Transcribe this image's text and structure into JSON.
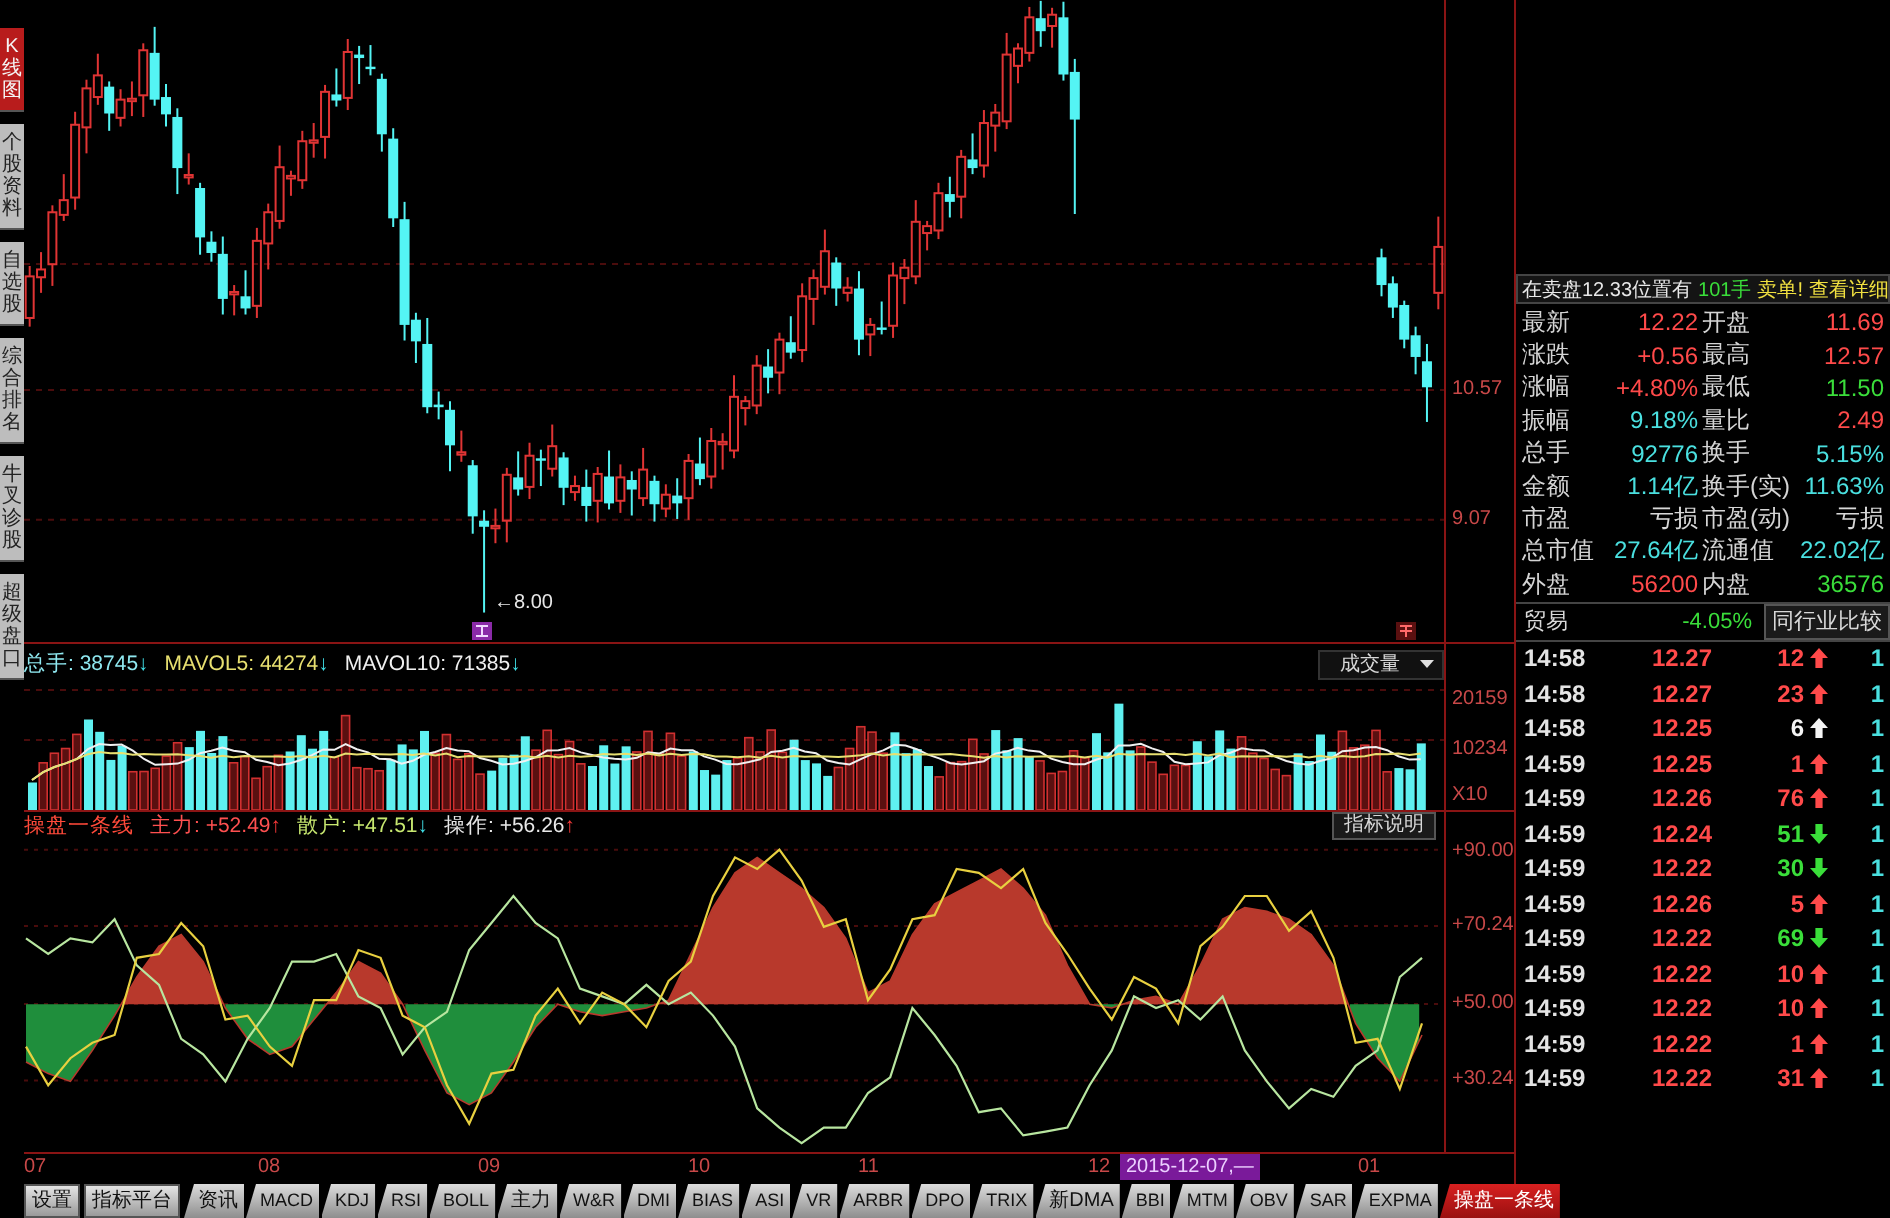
{
  "sidebar": {
    "tabs": [
      {
        "label": "K线图",
        "selected": true
      },
      {
        "label": "个股资料",
        "selected": false
      },
      {
        "label": "自选股",
        "selected": false
      },
      {
        "label": "综合排名",
        "selected": false
      },
      {
        "label": "牛叉诊股",
        "selected": false
      },
      {
        "label": "超级盘口",
        "selected": false
      }
    ]
  },
  "price_chart": {
    "low_marker": "←8.00",
    "chart_data": {
      "type": "candlestick",
      "grid": true,
      "ylim": [
        7.66,
        15.07
      ],
      "yticks": [
        {
          "value": 10.57,
          "label": "10.57"
        },
        {
          "value": 9.07,
          "label": "9.07"
        }
      ],
      "categories": [
        null,
        null,
        null,
        null,
        null,
        null,
        null,
        null,
        null,
        null,
        null,
        null,
        null,
        null,
        null,
        null,
        null,
        null,
        null,
        null,
        null,
        null,
        null,
        null,
        null,
        null,
        null,
        null,
        null,
        null,
        null,
        null,
        null,
        null,
        null,
        null,
        null,
        null,
        null,
        null,
        null,
        null,
        null,
        null,
        null,
        null,
        null,
        null,
        null,
        null,
        null,
        null,
        null,
        null,
        null,
        null,
        null,
        null,
        null,
        null,
        null,
        null,
        null,
        null,
        null,
        null,
        null,
        null,
        null,
        null,
        null,
        null,
        null,
        null,
        null,
        null,
        null,
        null,
        null,
        null,
        null,
        null,
        null,
        null,
        null,
        null,
        null,
        null,
        null,
        null,
        null,
        null,
        null,
        null,
        null,
        null,
        null,
        null,
        null,
        null,
        null,
        null,
        null,
        null,
        null,
        null,
        null,
        null,
        null,
        null,
        null,
        null,
        null,
        null,
        null,
        null,
        null,
        null,
        null,
        null,
        null,
        null,
        null,
        null,
        null
      ],
      "ohlc": [
        [
          11.4,
          12.0,
          11.3,
          11.88
        ],
        [
          11.87,
          12.16,
          11.69,
          11.96
        ],
        [
          12.02,
          12.7,
          11.77,
          12.62
        ],
        [
          12.59,
          13.06,
          12.52,
          12.76
        ],
        [
          12.79,
          13.78,
          12.65,
          13.63
        ],
        [
          13.6,
          14.15,
          13.3,
          14.05
        ],
        [
          13.95,
          14.45,
          13.86,
          14.2
        ],
        [
          14.07,
          14.13,
          13.56,
          13.76
        ],
        [
          13.71,
          14.04,
          13.61,
          13.92
        ],
        [
          13.91,
          14.13,
          13.73,
          13.93
        ],
        [
          13.97,
          14.57,
          13.72,
          14.49
        ],
        [
          14.46,
          14.76,
          13.85,
          13.92
        ],
        [
          13.95,
          14.1,
          13.61,
          13.75
        ],
        [
          13.72,
          13.82,
          12.83,
          13.13
        ],
        [
          13.03,
          13.3,
          12.94,
          13.05
        ],
        [
          12.9,
          12.96,
          12.13,
          12.33
        ],
        [
          12.28,
          12.4,
          12.05,
          12.15
        ],
        [
          12.14,
          12.34,
          11.44,
          11.62
        ],
        [
          11.68,
          11.78,
          11.43,
          11.7
        ],
        [
          11.65,
          11.95,
          11.44,
          11.51
        ],
        [
          11.54,
          12.44,
          11.4,
          12.29
        ],
        [
          12.26,
          12.72,
          11.96,
          12.62
        ],
        [
          12.52,
          13.39,
          12.43,
          13.14
        ],
        [
          13.01,
          13.1,
          12.81,
          13.04
        ],
        [
          12.99,
          13.56,
          12.89,
          13.44
        ],
        [
          13.43,
          13.65,
          13.25,
          13.45
        ],
        [
          13.49,
          14.09,
          13.24,
          14.01
        ],
        [
          13.98,
          14.28,
          13.84,
          13.91
        ],
        [
          13.94,
          14.62,
          13.8,
          14.47
        ],
        [
          14.44,
          14.54,
          14.1,
          14.4
        ],
        [
          14.3,
          14.55,
          14.2,
          14.29
        ],
        [
          14.16,
          14.22,
          13.32,
          13.52
        ],
        [
          13.47,
          13.59,
          12.45,
          12.55
        ],
        [
          12.54,
          12.74,
          11.14,
          11.32
        ],
        [
          11.38,
          11.46,
          10.88,
          11.13
        ],
        [
          11.1,
          11.4,
          10.3,
          10.37
        ],
        [
          10.4,
          10.55,
          10.23,
          10.37
        ],
        [
          10.34,
          10.44,
          9.63,
          9.93
        ],
        [
          9.83,
          10.1,
          9.74,
          9.85
        ],
        [
          9.7,
          9.76,
          8.91,
          9.11
        ],
        [
          9.06,
          9.18,
          8.0,
          8.99
        ],
        [
          8.98,
          9.2,
          8.8,
          9.0
        ],
        [
          9.06,
          9.67,
          8.81,
          9.59
        ],
        [
          9.56,
          9.86,
          9.35,
          9.42
        ],
        [
          9.45,
          9.96,
          9.31,
          9.81
        ],
        [
          9.78,
          9.88,
          9.46,
          9.76
        ],
        [
          9.66,
          10.17,
          9.57,
          9.92
        ],
        [
          9.79,
          9.85,
          9.24,
          9.44
        ],
        [
          9.39,
          9.58,
          9.29,
          9.46
        ],
        [
          9.45,
          9.65,
          9.05,
          9.23
        ],
        [
          9.29,
          9.68,
          9.04,
          9.6
        ],
        [
          9.57,
          9.87,
          9.19,
          9.26
        ],
        [
          9.29,
          9.71,
          9.15,
          9.56
        ],
        [
          9.53,
          9.63,
          9.12,
          9.42
        ],
        [
          9.32,
          9.9,
          9.23,
          9.65
        ],
        [
          9.52,
          9.58,
          9.05,
          9.25
        ],
        [
          9.2,
          9.48,
          9.1,
          9.36
        ],
        [
          9.35,
          9.55,
          9.08,
          9.26
        ],
        [
          9.32,
          9.83,
          9.07,
          9.75
        ],
        [
          9.72,
          10.02,
          9.47,
          9.54
        ],
        [
          9.57,
          10.13,
          9.43,
          9.98
        ],
        [
          9.95,
          10.07,
          9.65,
          9.97
        ],
        [
          9.87,
          10.74,
          9.78,
          10.49
        ],
        [
          10.36,
          10.5,
          10.16,
          10.44
        ],
        [
          10.39,
          10.97,
          10.29,
          10.85
        ],
        [
          10.84,
          11.04,
          10.53,
          10.71
        ],
        [
          10.77,
          11.23,
          10.52,
          11.15
        ],
        [
          11.12,
          11.42,
          10.93,
          11.0
        ],
        [
          11.03,
          11.8,
          10.89,
          11.65
        ],
        [
          11.62,
          11.96,
          11.32,
          11.86
        ],
        [
          11.76,
          12.42,
          11.67,
          12.17
        ],
        [
          12.04,
          12.1,
          11.54,
          11.74
        ],
        [
          11.69,
          11.87,
          11.59,
          11.75
        ],
        [
          11.74,
          11.94,
          10.97,
          11.15
        ],
        [
          11.21,
          11.4,
          10.96,
          11.32
        ],
        [
          11.29,
          11.59,
          11.21,
          11.28
        ],
        [
          11.31,
          12.04,
          11.17,
          11.89
        ],
        [
          11.86,
          12.08,
          11.56,
          11.98
        ],
        [
          11.88,
          12.76,
          11.79,
          12.51
        ],
        [
          12.38,
          12.52,
          12.18,
          12.46
        ],
        [
          12.41,
          12.96,
          12.31,
          12.84
        ],
        [
          12.83,
          13.03,
          12.56,
          12.74
        ],
        [
          12.8,
          13.34,
          12.55,
          13.26
        ],
        [
          13.23,
          13.53,
          13.06,
          13.13
        ],
        [
          13.16,
          13.8,
          13.02,
          13.65
        ],
        [
          13.62,
          13.87,
          13.32,
          13.77
        ],
        [
          13.67,
          14.69,
          13.58,
          14.44
        ],
        [
          14.31,
          14.57,
          14.11,
          14.51
        ],
        [
          14.46,
          14.99,
          14.36,
          14.87
        ],
        [
          14.86,
          15.06,
          14.53,
          14.71
        ],
        [
          14.77,
          14.98,
          14.52,
          14.9
        ],
        [
          14.87,
          15.05,
          14.14,
          14.21
        ],
        [
          14.24,
          14.39,
          12.6,
          13.69
        ],
        null,
        null,
        null,
        null,
        null,
        null,
        null,
        null,
        null,
        null,
        null,
        null,
        null,
        null,
        null,
        null,
        null,
        null,
        null,
        null,
        null,
        null,
        null,
        null,
        null,
        null,
        [
          12.1,
          12.2,
          11.65,
          11.78
        ],
        [
          11.8,
          11.88,
          11.4,
          11.52
        ],
        [
          11.55,
          11.6,
          11.05,
          11.15
        ],
        [
          11.2,
          11.3,
          10.75,
          10.95
        ],
        [
          10.9,
          11.1,
          10.2,
          10.6
        ],
        [
          11.69,
          12.57,
          11.5,
          12.22
        ]
      ]
    }
  },
  "volume_chart": {
    "legend": [
      {
        "text": "总手: 38745",
        "arrow": "↓",
        "rising": false,
        "color": "#8fe8f0"
      },
      {
        "text": "MAVOL5: 44274",
        "arrow": "↓",
        "rising": false,
        "color": "#e8e070"
      },
      {
        "text": "MAVOL10: 71385",
        "arrow": "↓",
        "rising": false,
        "color": "#f0f0f0"
      }
    ],
    "selector": "成交量",
    "axis_labels": [
      "20159",
      "10234",
      "X10"
    ]
  },
  "indicator_chart": {
    "name": "操盘一条线",
    "legend": [
      {
        "text": "主力: +52.49",
        "arrow": "↑",
        "rising": true,
        "color": "#ff5050"
      },
      {
        "text": "散户: +47.51",
        "arrow": "↓",
        "rising": false,
        "color": "#c8e870"
      },
      {
        "text": "操作: +56.26",
        "arrow": "↑",
        "rising": true,
        "color": "#e8e8e8"
      }
    ],
    "help_button": "指标说明",
    "chart_data": {
      "type": "line",
      "grid": true,
      "ylim": [
        11.7,
        92.5
      ],
      "yticks": [
        {
          "value": 90,
          "label": "+90.00"
        },
        {
          "value": 70.24,
          "label": "+70.24"
        },
        {
          "value": 50,
          "label": "+50.00"
        },
        {
          "value": 30.24,
          "label": "+30.24"
        }
      ],
      "series": [
        {
          "color": "#b8392c",
          "values": [
            35,
            32,
            30,
            38,
            47,
            57,
            65,
            68,
            61,
            49,
            41,
            37,
            39,
            46,
            53,
            61,
            58,
            50,
            38,
            27,
            24,
            27,
            35,
            44,
            50,
            48,
            47,
            48,
            49,
            51,
            63,
            75,
            84,
            88,
            84,
            80,
            75,
            67,
            53,
            56,
            68,
            76,
            79,
            82,
            85,
            80,
            73,
            60,
            50,
            49,
            51,
            52,
            50,
            60,
            72,
            75,
            74,
            72,
            68,
            60,
            45,
            36,
            30,
            42
          ]
        },
        {
          "color": "#b8e6a0",
          "values": [
            67,
            63,
            67,
            66,
            72,
            60,
            55,
            41,
            37,
            30,
            41,
            49,
            61,
            61,
            63,
            52,
            49,
            37,
            44,
            48,
            64,
            71,
            78,
            71,
            67,
            54,
            52,
            50,
            55,
            50,
            53,
            47,
            39,
            23,
            18,
            14,
            18,
            18,
            27,
            31,
            49,
            42,
            34,
            22,
            23,
            16,
            17,
            18,
            29,
            38,
            52,
            49,
            51,
            46,
            52,
            38,
            30,
            23,
            28,
            26,
            34,
            38,
            57,
            62
          ]
        },
        {
          "color": "#e8d040",
          "values": [
            39,
            29,
            36,
            40,
            42,
            62,
            63,
            71,
            65,
            46,
            47,
            39,
            34,
            51,
            51,
            64,
            62,
            47,
            44,
            29,
            19,
            32,
            33,
            47,
            54,
            45,
            53,
            50,
            44,
            56,
            61,
            78,
            88,
            85,
            90,
            82,
            70,
            72,
            51,
            59,
            72,
            73,
            85,
            84,
            80,
            85,
            71,
            63,
            54,
            46,
            57,
            54,
            45,
            65,
            70,
            78,
            78,
            69,
            74,
            62,
            40,
            41,
            28,
            45
          ]
        }
      ]
    }
  },
  "time_axis": {
    "labels": [
      "07",
      "08",
      "09",
      "10",
      "11",
      "12",
      "01"
    ],
    "cursor_date": "2015-12-07,—"
  },
  "toolbar": {
    "buttons": [
      "设置",
      "指标平台"
    ],
    "tabs": [
      {
        "label": "资讯",
        "selected": false
      },
      {
        "label": "MACD",
        "selected": false
      },
      {
        "label": "KDJ",
        "selected": false
      },
      {
        "label": "RSI",
        "selected": false
      },
      {
        "label": "BOLL",
        "selected": false
      },
      {
        "label": "主力",
        "selected": false
      },
      {
        "label": "W&R",
        "selected": false
      },
      {
        "label": "DMI",
        "selected": false
      },
      {
        "label": "BIAS",
        "selected": false
      },
      {
        "label": "ASI",
        "selected": false
      },
      {
        "label": "VR",
        "selected": false
      },
      {
        "label": "ARBR",
        "selected": false
      },
      {
        "label": "DPO",
        "selected": false
      },
      {
        "label": "TRIX",
        "selected": false
      },
      {
        "label": "新DMA",
        "selected": false
      },
      {
        "label": "BBI",
        "selected": false
      },
      {
        "label": "MTM",
        "selected": false
      },
      {
        "label": "OBV",
        "selected": false
      },
      {
        "label": "SAR",
        "selected": false
      },
      {
        "label": "EXPMA",
        "selected": false
      },
      {
        "label": "操盘一条线",
        "selected": true
      }
    ]
  },
  "quote_panel": {
    "notice": {
      "text": "在卖盘12.33位置有",
      "volume": "101手",
      "order_type": "卖单!",
      "link": "查看详细"
    },
    "stats": [
      {
        "cells": [
          {
            "label": "最新",
            "value": "12.22",
            "color": "#ff4a4a"
          },
          {
            "label": "开盘",
            "value": "11.69",
            "color": "#ff4a4a"
          }
        ]
      },
      {
        "cells": [
          {
            "label": "涨跌",
            "value": "+0.56",
            "color": "#ff4a4a"
          },
          {
            "label": "最高",
            "value": "12.57",
            "color": "#ff4a4a"
          }
        ]
      },
      {
        "cells": [
          {
            "label": "涨幅",
            "value": "+4.80%",
            "color": "#ff4a4a"
          },
          {
            "label": "最低",
            "value": "11.50",
            "color": "#3ade3a"
          }
        ]
      },
      {
        "cells": [
          {
            "label": "振幅",
            "value": "9.18%",
            "color": "#4ae0e0"
          },
          {
            "label": "量比",
            "value": "2.49",
            "color": "#ff4a4a"
          }
        ]
      },
      {
        "cells": [
          {
            "label": "总手",
            "value": "92776",
            "color": "#4ae0e0"
          },
          {
            "label": "换手",
            "value": "5.15%",
            "color": "#4ae0e0"
          }
        ]
      },
      {
        "cells": [
          {
            "label": "金额",
            "value": "1.14亿",
            "color": "#4ae0e0"
          },
          {
            "label": "换手(实)",
            "value": "11.63%",
            "color": "#4ae0e0"
          }
        ]
      },
      {
        "cells": [
          {
            "label": "市盈",
            "value": "亏损",
            "color": "#d8d8d8"
          },
          {
            "label": "市盈(动)",
            "value": "亏损",
            "color": "#d8d8d8"
          }
        ]
      },
      {
        "cells": [
          {
            "label": "总市值",
            "value": "27.64亿",
            "color": "#4ae0e0"
          },
          {
            "label": "流通值",
            "value": "22.02亿",
            "color": "#4ae0e0"
          }
        ]
      },
      {
        "cells": [
          {
            "label": "外盘",
            "value": "56200",
            "color": "#ff4a4a"
          },
          {
            "label": "内盘",
            "value": "36576",
            "color": "#3ade3a"
          }
        ]
      }
    ],
    "industry": {
      "name": "贸易",
      "change": "-4.05%",
      "button": "同行业比较"
    },
    "trades": [
      {
        "time": "14:58",
        "price": "12.27",
        "volume": "12",
        "kind": "buy",
        "column_4": "1"
      },
      {
        "time": "14:58",
        "price": "12.27",
        "volume": "23",
        "kind": "buy",
        "column_4": "1"
      },
      {
        "time": "14:58",
        "price": "12.25",
        "volume": "6",
        "kind": "neutral",
        "column_4": "1"
      },
      {
        "time": "14:59",
        "price": "12.25",
        "volume": "1",
        "kind": "buy",
        "column_4": "1"
      },
      {
        "time": "14:59",
        "price": "12.26",
        "volume": "76",
        "kind": "buy",
        "column_4": "1"
      },
      {
        "time": "14:59",
        "price": "12.24",
        "volume": "51",
        "kind": "sell",
        "column_4": "1"
      },
      {
        "time": "14:59",
        "price": "12.22",
        "volume": "30",
        "kind": "sell",
        "column_4": "1"
      },
      {
        "time": "14:59",
        "price": "12.26",
        "volume": "5",
        "kind": "buy",
        "column_4": "1"
      },
      {
        "time": "14:59",
        "price": "12.22",
        "volume": "69",
        "kind": "sell",
        "column_4": "1"
      },
      {
        "time": "14:59",
        "price": "12.22",
        "volume": "10",
        "kind": "buy",
        "column_4": "1"
      },
      {
        "time": "14:59",
        "price": "12.22",
        "volume": "10",
        "kind": "buy",
        "column_4": "1"
      },
      {
        "time": "14:59",
        "price": "12.22",
        "volume": "1",
        "kind": "buy",
        "column_4": "1"
      },
      {
        "time": "14:59",
        "price": "12.22",
        "volume": "31",
        "kind": "buy",
        "column_4": "1"
      }
    ]
  }
}
